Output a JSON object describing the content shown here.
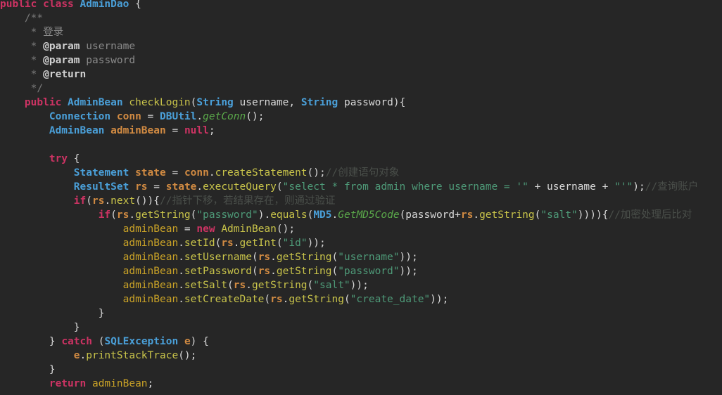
{
  "editor": {
    "language": "java",
    "class_name": "AdminDao",
    "method_name": "checkLogin",
    "background_color": "#262626",
    "highlight_color": "#19504f",
    "colors": {
      "keyword": "#cc3363",
      "type": "#4a9fd8",
      "variable": "#d08a42",
      "method": "#c9c44a",
      "string": "#4e9a78",
      "comment": "#4a4f4a",
      "static_method": "#5aa84a",
      "javadoc_tag": "#d0d0d0",
      "plain_text": "#d8d8d8"
    }
  },
  "code": {
    "line_01": {
      "kw_public": "public",
      "kw_class": "class",
      "type_name": "AdminDao",
      "brace": "{"
    },
    "line_02": {
      "doc": "/**"
    },
    "line_03": {
      "star": "*",
      "text": "登录"
    },
    "line_04": {
      "star": "*",
      "tag": "@param",
      "value": "username"
    },
    "line_05": {
      "star": "*",
      "tag": "@param",
      "value": "password"
    },
    "line_06": {
      "star": "*",
      "tag": "@return"
    },
    "line_07": {
      "doc": "*/"
    },
    "line_08": {
      "kw_public": "public",
      "ret_type": "AdminBean",
      "method": "checkLogin",
      "paren_open": "(",
      "p1_type": "String",
      "p1_name": " username",
      "comma": ", ",
      "p2_type": "String",
      "p2_name": " password",
      "tail": "){"
    },
    "line_09": {
      "type": "Connection",
      "var": "conn",
      "eq": " = ",
      "cls": "DBUtil",
      "dot": ".",
      "static_method": "getConn",
      "tail": "();"
    },
    "line_10": {
      "type": "AdminBean",
      "var": "adminBean",
      "eq": " = ",
      "kw_null": "null",
      "semi": ";"
    },
    "line_11": {
      "blank": ""
    },
    "line_12": {
      "kw_try": "try",
      "brace": " {"
    },
    "line_13": {
      "type": "Statement",
      "var": "state",
      "eq": " = ",
      "obj": "conn",
      "dot": ".",
      "method": "createStatement",
      "tail": "();",
      "comment": "//创建语句对象"
    },
    "line_14": {
      "type": "ResultSet",
      "var": "rs",
      "eq": " = ",
      "obj": "state",
      "dot": ".",
      "method": "executeQuery",
      "paren": "(",
      "str1": "\"select * from admin where username = '\"",
      "plus1": " + ",
      "arg": "username",
      "plus2": " + ",
      "str2": "\"'\"",
      "tail": ");",
      "comment": "//查询账户"
    },
    "line_15": {
      "kw_if": "if",
      "expr_open": "(",
      "obj": "rs",
      "dot": ".",
      "method": "next",
      "tail": "()){",
      "comment": "//指针下移，若结果存在，则通过验证"
    },
    "line_16": {
      "kw_if": "if",
      "paren": "(",
      "obj": "rs",
      "dot": ".",
      "m_getString": "getString",
      "p1": "(",
      "str_password": "\"password\"",
      "p2": ").",
      "m_equals": "equals",
      "p3": "(",
      "cls_md5": "MD5",
      "dot2": ".",
      "static_method": "GetMD5Code",
      "p4": "(",
      "arg_password": "password",
      "plus": "+",
      "obj2": "rs",
      "dot3": ".",
      "m_getString2": "getString",
      "p5": "(",
      "str_salt": "\"salt\"",
      "tail": ")))){",
      "comment": "//加密处理后比对"
    },
    "line_17": {
      "var": "adminBean",
      "eq": " = ",
      "kw_new": "new",
      "type": "AdminBean",
      "tail": "();"
    },
    "line_18": {
      "var": "adminBean",
      "dot": ".",
      "method": "setId",
      "p1": "(",
      "obj": "rs",
      "dot2": ".",
      "m2": "getInt",
      "p2": "(",
      "str": "\"id\"",
      "tail": "));"
    },
    "line_19": {
      "var": "adminBean",
      "dot": ".",
      "method": "setUsername",
      "p1": "(",
      "obj": "rs",
      "dot2": ".",
      "m2": "getString",
      "p2": "(",
      "str": "\"username\"",
      "tail": "));"
    },
    "line_20": {
      "var": "adminBean",
      "dot": ".",
      "method": "setPassword",
      "p1": "(",
      "obj": "rs",
      "dot2": ".",
      "m2": "getString",
      "p2": "(",
      "str": "\"password\"",
      "tail": "));"
    },
    "line_21": {
      "var": "adminBean",
      "dot": ".",
      "method": "setSalt",
      "p1": "(",
      "obj": "rs",
      "dot2": ".",
      "m2": "getString",
      "p2": "(",
      "str": "\"salt\"",
      "tail": "));"
    },
    "line_22": {
      "var": "adminBean",
      "dot": ".",
      "method": "setCreateDate",
      "p1": "(",
      "obj": "rs",
      "dot2": ".",
      "m2": "getString",
      "p2": "(",
      "str": "\"create_date\"",
      "tail": "));"
    },
    "line_23": {
      "brace": "}"
    },
    "line_24": {
      "brace": "}"
    },
    "line_25": {
      "brace": "} ",
      "kw_catch": "catch",
      "paren": " (",
      "exc_type": "SQLException",
      "exc_var": "e",
      "tail": ") {"
    },
    "line_26": {
      "obj": "e",
      "dot": ".",
      "method": "printStackTrace",
      "tail": "();"
    },
    "line_27": {
      "brace": "}"
    },
    "line_28": {
      "kw_return": "return",
      "var": " adminBean",
      "semi": ";"
    }
  }
}
